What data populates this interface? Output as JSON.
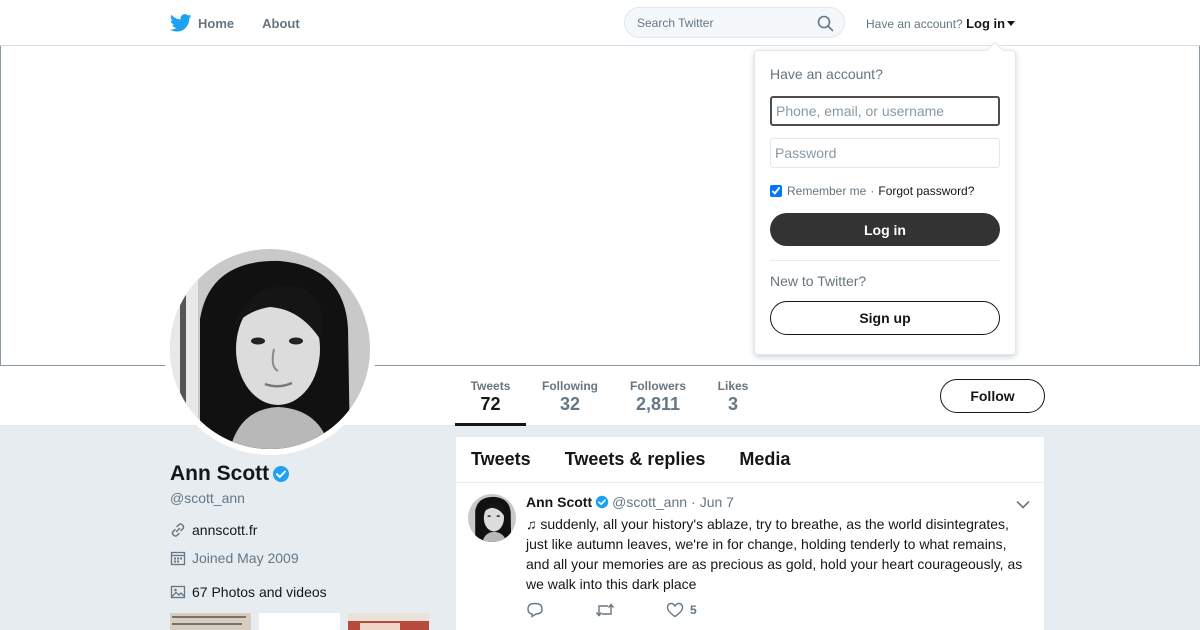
{
  "nav": {
    "home_label": "Home",
    "about_label": "About",
    "search_placeholder": "Search Twitter",
    "have_account": "Have an account?",
    "login_label": "Log in"
  },
  "profile": {
    "name": "Ann Scott",
    "handle": "@scott_ann",
    "website": "annscott.fr",
    "joined": "Joined May 2009",
    "photos_label": "67 Photos and videos"
  },
  "stats": [
    {
      "label": "Tweets",
      "value": "72"
    },
    {
      "label": "Following",
      "value": "32"
    },
    {
      "label": "Followers",
      "value": "2,811"
    },
    {
      "label": "Likes",
      "value": "3"
    }
  ],
  "follow_label": "Follow",
  "timeline": {
    "tabs": [
      "Tweets",
      "Tweets & replies",
      "Media"
    ],
    "tweet": {
      "name": "Ann Scott",
      "handle": "@scott_ann",
      "separator": "·",
      "date": "Jun 7",
      "text": "♫ suddenly, all your history's ablaze, try to breathe, as the world disintegrates, just like autumn leaves, we're in for change, holding tenderly to what remains, and all your memories are as precious as gold, hold your heart courageously, as we walk into this dark place",
      "like_count": "5"
    }
  },
  "login_dropdown": {
    "heading": "Have an account?",
    "username_placeholder": "Phone, email, or username",
    "password_placeholder": "Password",
    "remember_label": "Remember me",
    "separator": "·",
    "forgot_label": "Forgot password?",
    "login_button": "Log in",
    "new_label": "New to Twitter?",
    "signup_button": "Sign up",
    "remember_checked": true
  },
  "icons": {
    "logo": "twitter-bird-icon",
    "search": "search-icon",
    "verified": "verified-badge-icon",
    "link": "link-icon",
    "calendar": "calendar-icon",
    "photos": "photo-icon",
    "reply": "reply-icon",
    "retweet": "retweet-icon",
    "like": "heart-icon",
    "menu": "chevron-down-icon"
  },
  "colors": {
    "brand_blue": "#1da1f2",
    "verified_blue": "#1da1f2",
    "text_primary": "#14171a",
    "text_secondary": "#657786",
    "background": "#e6ecf0"
  }
}
